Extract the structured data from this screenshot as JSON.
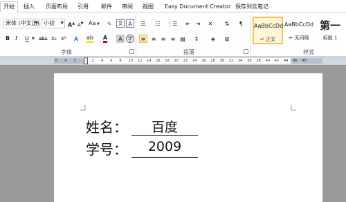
{
  "tabs": [
    "开始",
    "插入",
    "页面布局",
    "引用",
    "邮件",
    "审阅",
    "视图",
    "Easy Document Creator",
    "保存到云笔记"
  ],
  "font": {
    "family": "宋体 (中文正)",
    "size": "小初",
    "grow_label": "A",
    "shrink_label": "A",
    "case_label": "Aa",
    "bold": "B",
    "italic": "I",
    "underline": "U",
    "strike": "abc",
    "subscript": "x₂",
    "superscript": "x²",
    "group_label": "字体"
  },
  "paragraph": {
    "group_label": "段落"
  },
  "styles": {
    "items": [
      {
        "sample": "AaBbCcDd",
        "name": "↵ 正文"
      },
      {
        "sample": "AaBbCcDd",
        "name": "↵ 无间隔"
      },
      {
        "sample": "第一",
        "name": "标题 1"
      }
    ],
    "group_label": "样式"
  },
  "ruler": {
    "numbers": [
      "6",
      "4",
      "2",
      "",
      "2",
      "4",
      "6",
      "8",
      "10",
      "12",
      "14",
      "16",
      "18",
      "20",
      "22",
      "24",
      "26",
      "28",
      "30",
      "32",
      "34",
      "36",
      "38",
      "40",
      "42",
      "44",
      "46",
      "48"
    ]
  },
  "document": {
    "rows": [
      {
        "label": "姓名：",
        "value": "百度"
      },
      {
        "label": "学号：",
        "value": "2009"
      }
    ]
  },
  "colors": {
    "selected_style_border": "#f2c55c",
    "page_bg": "#9b9b9b",
    "ribbon_bg": "#fdfdfd"
  }
}
